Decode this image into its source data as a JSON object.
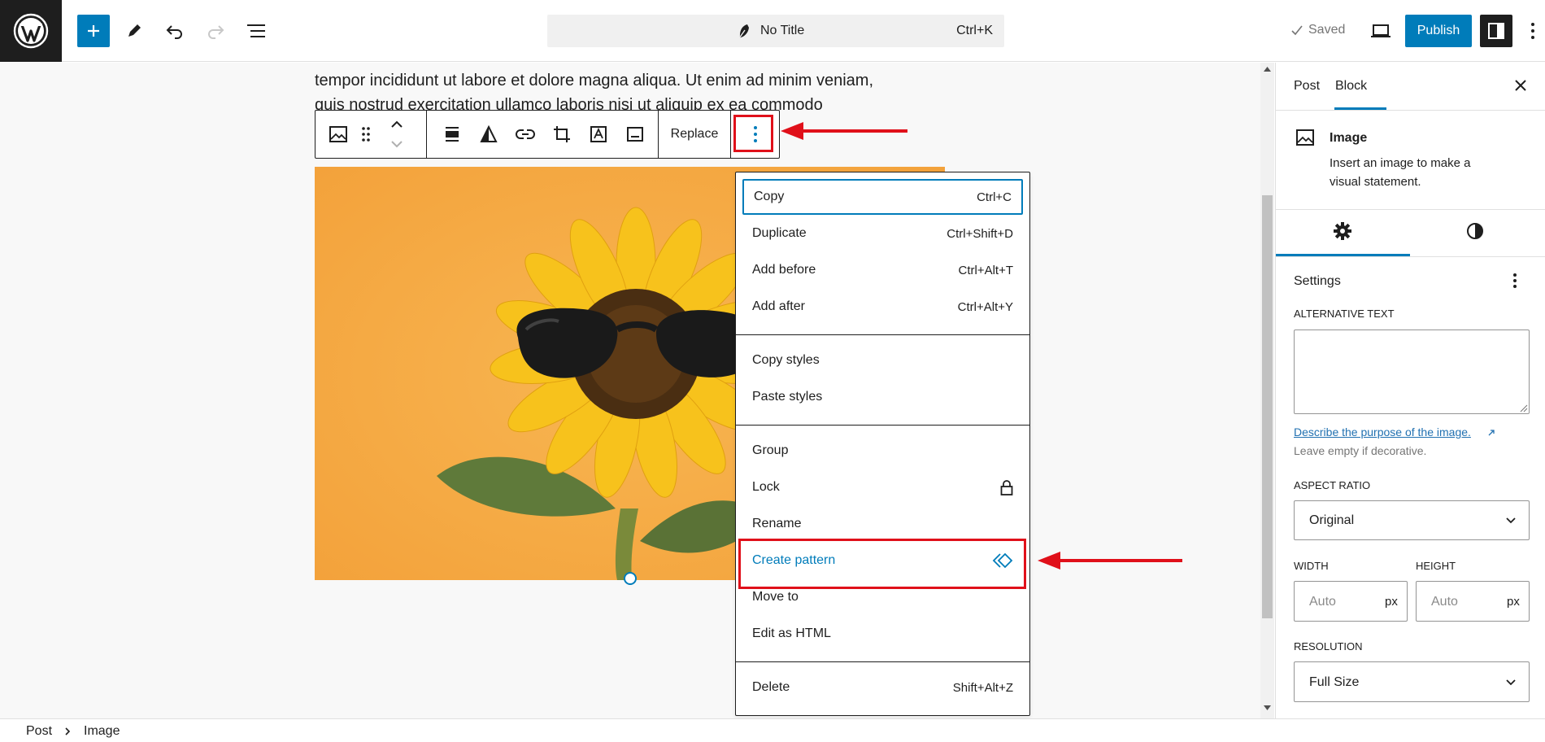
{
  "header": {
    "title": "No Title",
    "shortcut": "Ctrl+K",
    "saved": "Saved",
    "publish": "Publish"
  },
  "content": {
    "line1": "tempor incididunt ut labore et dolore magna aliqua. Ut enim ad minim veniam,",
    "line2": "quis nostrud exercitation ullamco laboris nisi ut aliquip ex ea commodo"
  },
  "toolbar": {
    "replace": "Replace"
  },
  "menu": {
    "group1": [
      {
        "label": "Copy",
        "shortcut": "Ctrl+C"
      },
      {
        "label": "Duplicate",
        "shortcut": "Ctrl+Shift+D"
      },
      {
        "label": "Add before",
        "shortcut": "Ctrl+Alt+T"
      },
      {
        "label": "Add after",
        "shortcut": "Ctrl+Alt+Y"
      }
    ],
    "group2": [
      {
        "label": "Copy styles"
      },
      {
        "label": "Paste styles"
      }
    ],
    "group3": [
      {
        "label": "Group"
      },
      {
        "label": "Lock"
      },
      {
        "label": "Rename"
      },
      {
        "label": "Create pattern"
      },
      {
        "label": "Move to"
      },
      {
        "label": "Edit as HTML"
      }
    ],
    "group4": [
      {
        "label": "Delete",
        "shortcut": "Shift+Alt+Z"
      }
    ]
  },
  "sidebar": {
    "tabs": [
      "Post",
      "Block"
    ],
    "block_name": "Image",
    "block_desc_1": "Insert an image to make a",
    "block_desc_2": "visual statement.",
    "settings": "Settings",
    "alt_label": "ALTERNATIVE TEXT",
    "alt_link": "Describe the purpose of the image.",
    "alt_help": "Leave empty if decorative.",
    "aspect_label": "ASPECT RATIO",
    "aspect_value": "Original",
    "width_label": "WIDTH",
    "height_label": "HEIGHT",
    "width_placeholder": "Auto",
    "height_placeholder": "Auto",
    "unit": "px",
    "resolution_label": "RESOLUTION",
    "resolution_value": "Full Size"
  },
  "breadcrumb": {
    "items": [
      "Post",
      "Image"
    ]
  },
  "colors": {
    "accent": "#007cba",
    "annotation": "#e0101a",
    "image_bg": "#f5ac46"
  }
}
